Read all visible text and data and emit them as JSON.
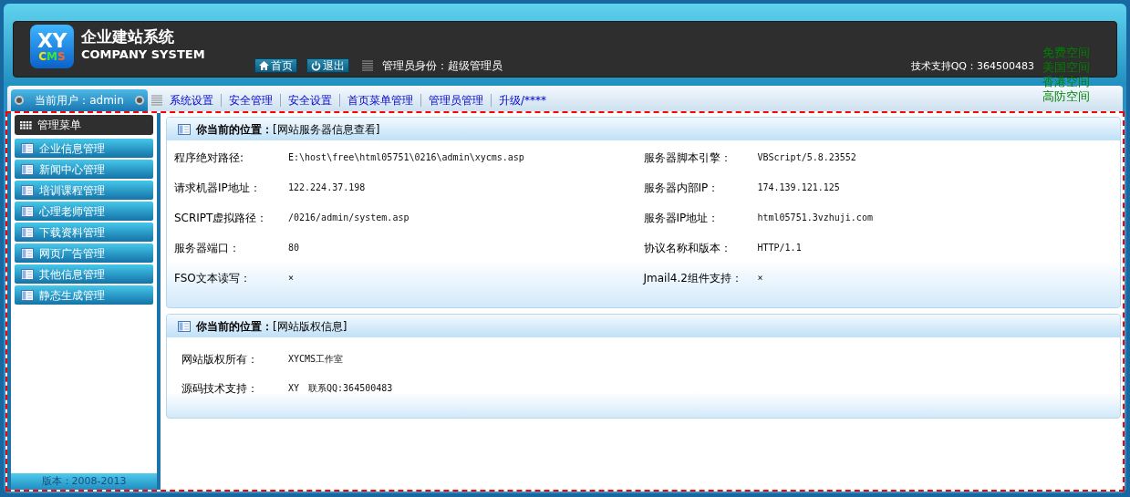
{
  "header": {
    "logo": {
      "top": "XY",
      "bottom": "CMS"
    },
    "title": "企业建站系统",
    "subtitle": "COMPANY SYSTEM",
    "buttons": [
      {
        "label": "首页",
        "kind": "home"
      },
      {
        "label": "退出",
        "kind": "logout"
      }
    ],
    "role": "管理员身份：超级管理员",
    "support": "技术支持QQ：364500483"
  },
  "ad_links": [
    "免费空间",
    "美国空间",
    "香港空间",
    "高防空间"
  ],
  "nav": {
    "current_user": "当前用户：admin",
    "items": [
      "系统设置",
      "安全管理",
      "安全设置",
      "首页菜单管理",
      "管理员管理",
      "升级/****"
    ]
  },
  "sidebar": {
    "title": "管理菜单",
    "items": [
      "企业信息管理",
      "新闻中心管理",
      "培训课程管理",
      "心理老师管理",
      "下载资料管理",
      "网页广告管理",
      "其他信息管理",
      "静态生成管理"
    ],
    "version": "版本：2008-2013"
  },
  "panels": [
    {
      "location_label": "你当前的位置：",
      "location": "[网站服务器信息查看]",
      "kind": "grid",
      "fields": [
        {
          "label": "程序绝对路径:",
          "value": "E:\\host\\free\\html05751\\0216\\admin\\xycms.asp"
        },
        {
          "label": "服务器脚本引擎：",
          "value": "VBScript/5.8.23552"
        },
        {
          "label": "请求机器IP地址：",
          "value": "122.224.37.198"
        },
        {
          "label": "服务器内部IP：",
          "value": "174.139.121.125"
        },
        {
          "label": "SCRIPT虚拟路径：",
          "value": "/0216/admin/system.asp"
        },
        {
          "label": "服务器IP地址：",
          "value": "html05751.3vzhuji.com"
        },
        {
          "label": "服务器端口：",
          "value": "80"
        },
        {
          "label": "协议名称和版本：",
          "value": "HTTP/1.1"
        },
        {
          "label": "FSO文本读写：",
          "value": "×"
        },
        {
          "label": "Jmail4.2组件支持：",
          "value": "×"
        }
      ]
    },
    {
      "location_label": "你当前的位置：",
      "location": "[网站版权信息]",
      "kind": "list",
      "fields": [
        {
          "label": "网站版权所有：",
          "value": "XYCMS工作室"
        },
        {
          "label": "源码技术支持：",
          "value": "XY　联系QQ:364500483"
        }
      ]
    }
  ]
}
